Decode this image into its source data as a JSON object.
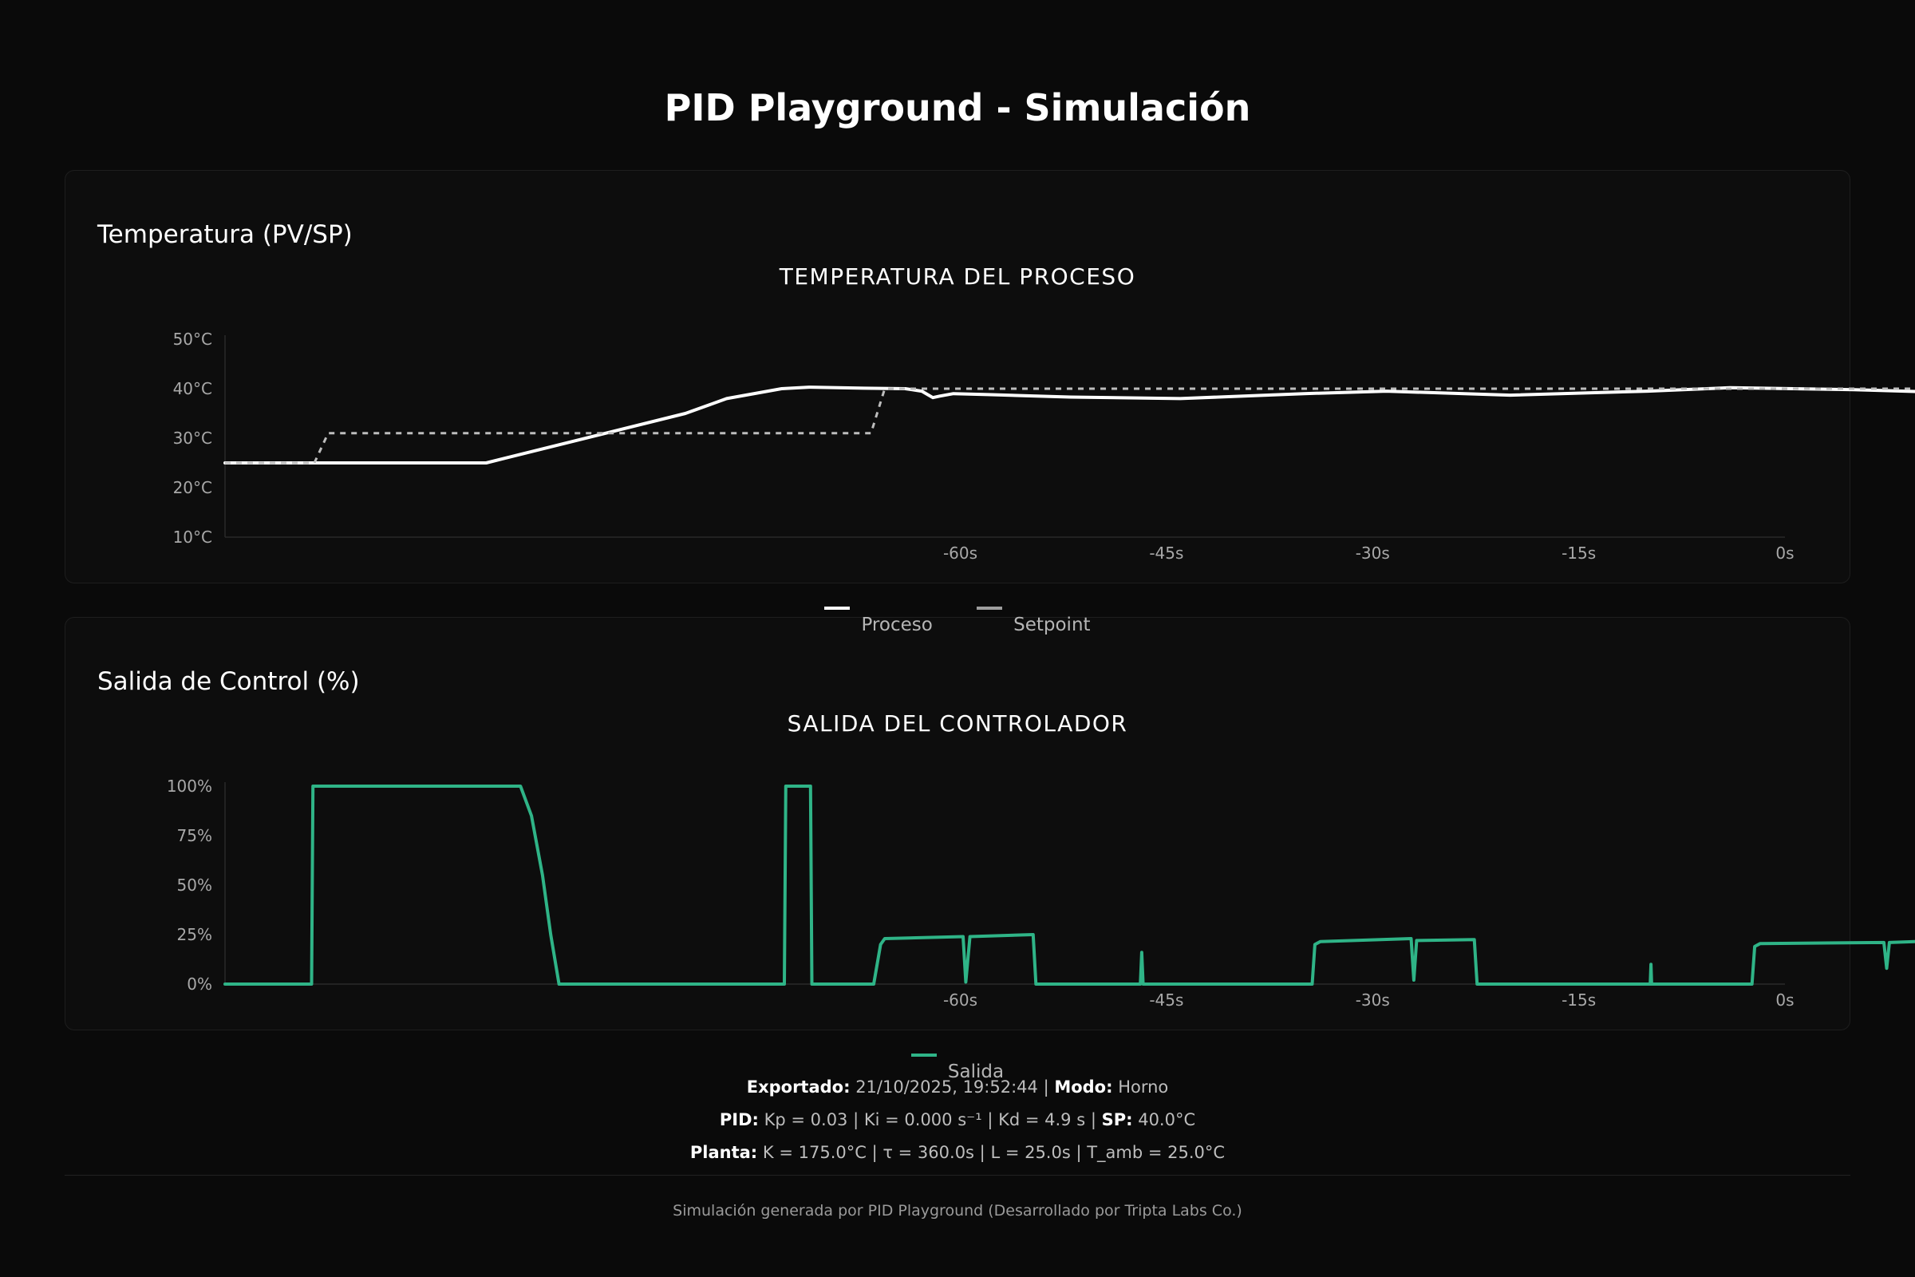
{
  "page": {
    "title": "PID Playground - Simulación"
  },
  "panels": {
    "temperature": {
      "card_title": "Temperatura (PV/SP)"
    },
    "output": {
      "card_title": "Salida de Control (%)"
    }
  },
  "legend_temp": {
    "process": "Proceso",
    "setpoint": "Setpoint"
  },
  "legend_out": {
    "output": "Salida"
  },
  "info": {
    "exported_label": "Exportado:",
    "exported_value": "21/10/2025, 19:52:44",
    "mode_label": "Modo:",
    "mode_value": "Horno",
    "pid_label": "PID:",
    "kp": "Kp = 0.03",
    "ki": "Ki = 0.000 s⁻¹",
    "kd": "Kd = 4.9 s",
    "sp_label": "SP:",
    "sp_value": "40.0°C",
    "plant_label": "Planta:",
    "plant_k": "K = 175.0°C",
    "plant_tau": "τ = 360.0s",
    "plant_l": "L = 25.0s",
    "plant_tamb": "T_amb = 25.0°C"
  },
  "footer": {
    "text": "Simulación generada por PID Playground (Desarrollado por Tripta Labs Co.)"
  },
  "colors": {
    "background": "#0a0a0a",
    "process": "#ffffff",
    "setpoint": "#bdbdbd",
    "output": "#2fb487"
  },
  "chart_data": [
    {
      "type": "line",
      "title": "TEMPERATURA DEL PROCESO",
      "ylim": [
        10,
        50
      ],
      "yticks": [
        10,
        20,
        30,
        40,
        50
      ],
      "ytick_labels": [
        "10°C",
        "20°C",
        "30°C",
        "40°C",
        "50°C"
      ],
      "xlim": [
        -113.5,
        0
      ],
      "xticks": [
        -60,
        -45,
        -30,
        -15,
        0
      ],
      "xtick_labels": [
        "-60s",
        "-45s",
        "-30s",
        "-15s",
        "0s"
      ],
      "legend": "bottom-center",
      "series": [
        {
          "name": "Proceso",
          "color": "#ffffff",
          "dash": false,
          "points": [
            [
              -113.5,
              25
            ],
            [
              -94.5,
              25
            ],
            [
              -80,
              35
            ],
            [
              -77,
              38
            ],
            [
              -73,
              40
            ],
            [
              -71,
              40.3
            ],
            [
              -67,
              40.1
            ],
            [
              -64,
              40
            ],
            [
              -62.8,
              39.5
            ],
            [
              -62,
              38.2
            ],
            [
              -61.5,
              38.5
            ],
            [
              -60.5,
              39
            ],
            [
              -58,
              38.8
            ],
            [
              -52,
              38.3
            ],
            [
              -44,
              38
            ],
            [
              -35,
              39
            ],
            [
              -29,
              39.5
            ],
            [
              -20,
              38.7
            ],
            [
              -10,
              39.5
            ],
            [
              -4,
              40.2
            ],
            [
              5,
              39.8
            ],
            [
              11,
              39.3
            ],
            [
              14,
              39.7
            ]
          ]
        },
        {
          "name": "Setpoint",
          "color": "#bdbdbd",
          "dash": true,
          "points": [
            [
              -113.5,
              25
            ],
            [
              -107,
              25
            ],
            [
              -106,
              31
            ],
            [
              -66.5,
              31
            ],
            [
              -65.5,
              40
            ],
            [
              14,
              40
            ]
          ]
        }
      ]
    },
    {
      "type": "line",
      "title": "SALIDA DEL CONTROLADOR",
      "ylim": [
        0,
        100
      ],
      "yticks": [
        0,
        25,
        50,
        75,
        100
      ],
      "ytick_labels": [
        "0%",
        "25%",
        "50%",
        "75%",
        "100%"
      ],
      "xlim": [
        -113.5,
        0
      ],
      "xticks": [
        -60,
        -45,
        -30,
        -15,
        0
      ],
      "xtick_labels": [
        "-60s",
        "-45s",
        "-30s",
        "-15s",
        "0s"
      ],
      "legend": "bottom-center",
      "series": [
        {
          "name": "Salida",
          "color": "#2fb487",
          "dash": false,
          "points": [
            [
              -113.5,
              0
            ],
            [
              -107.2,
              0
            ],
            [
              -107.1,
              100
            ],
            [
              -92,
              100
            ],
            [
              -91.2,
              85
            ],
            [
              -90.4,
              55
            ],
            [
              -89.8,
              25
            ],
            [
              -89.2,
              0
            ],
            [
              -72.8,
              0
            ],
            [
              -72.7,
              100
            ],
            [
              -70.9,
              100
            ],
            [
              -70.8,
              0
            ],
            [
              -66.3,
              0
            ],
            [
              -65.8,
              20
            ],
            [
              -65.5,
              23
            ],
            [
              -59.8,
              24
            ],
            [
              -59.6,
              1
            ],
            [
              -59.3,
              24
            ],
            [
              -54.7,
              25
            ],
            [
              -54.5,
              0
            ],
            [
              -46.9,
              0
            ],
            [
              -46.8,
              16
            ],
            [
              -46.7,
              0
            ],
            [
              -34.4,
              0
            ],
            [
              -34.2,
              20
            ],
            [
              -33.8,
              21.5
            ],
            [
              -27.2,
              23
            ],
            [
              -27,
              2
            ],
            [
              -26.8,
              22
            ],
            [
              -22.6,
              22.5
            ],
            [
              -22.4,
              0
            ],
            [
              -9.8,
              0
            ],
            [
              -9.75,
              10
            ],
            [
              -9.7,
              0
            ],
            [
              -2.4,
              0
            ],
            [
              -2.2,
              19
            ],
            [
              -1.8,
              20.5
            ],
            [
              7.2,
              21
            ],
            [
              7.4,
              8
            ],
            [
              7.6,
              21
            ],
            [
              11.7,
              22
            ],
            [
              11.8,
              0
            ],
            [
              13.9,
              0
            ]
          ]
        }
      ]
    }
  ]
}
